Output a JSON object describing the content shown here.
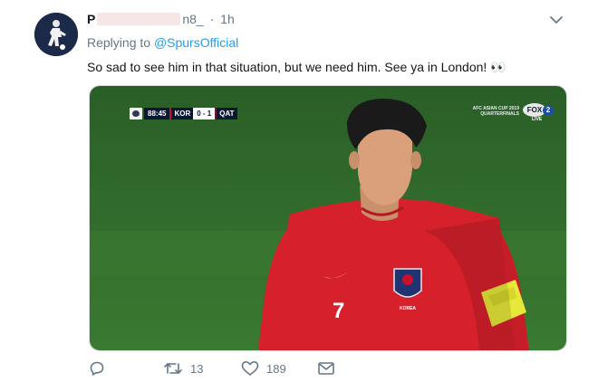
{
  "tweet": {
    "name_prefix": "P",
    "handle_suffix": "n8_",
    "separator": "·",
    "time": "1h",
    "replying_label": "Replying to",
    "replying_mention": "@SpursOfficial",
    "text": "So sad to see him in that situation, but we need him. See ya in London! 👀",
    "avatar_icon": "player-silhouette-icon",
    "caret_icon": "chevron-down-icon"
  },
  "media": {
    "scorebug": {
      "time": "88:45",
      "home": "KOR",
      "score": "0 - 1",
      "away": "QAT"
    },
    "broadcast": {
      "line1": "AFC ASIAN CUP 2019",
      "line2": "QUARTERFINALS",
      "channel": "FOX",
      "number": "2",
      "live": "LIVE"
    },
    "jersey": {
      "number": "7",
      "team_text": "KOREA"
    }
  },
  "actions": {
    "reply_count": "",
    "retweet_count": "13",
    "like_count": "189",
    "message_count": ""
  },
  "colors": {
    "link": "#1da1f2",
    "muted": "#657786",
    "pitch": "#2f6b2a",
    "shirt": "#d6202c"
  }
}
